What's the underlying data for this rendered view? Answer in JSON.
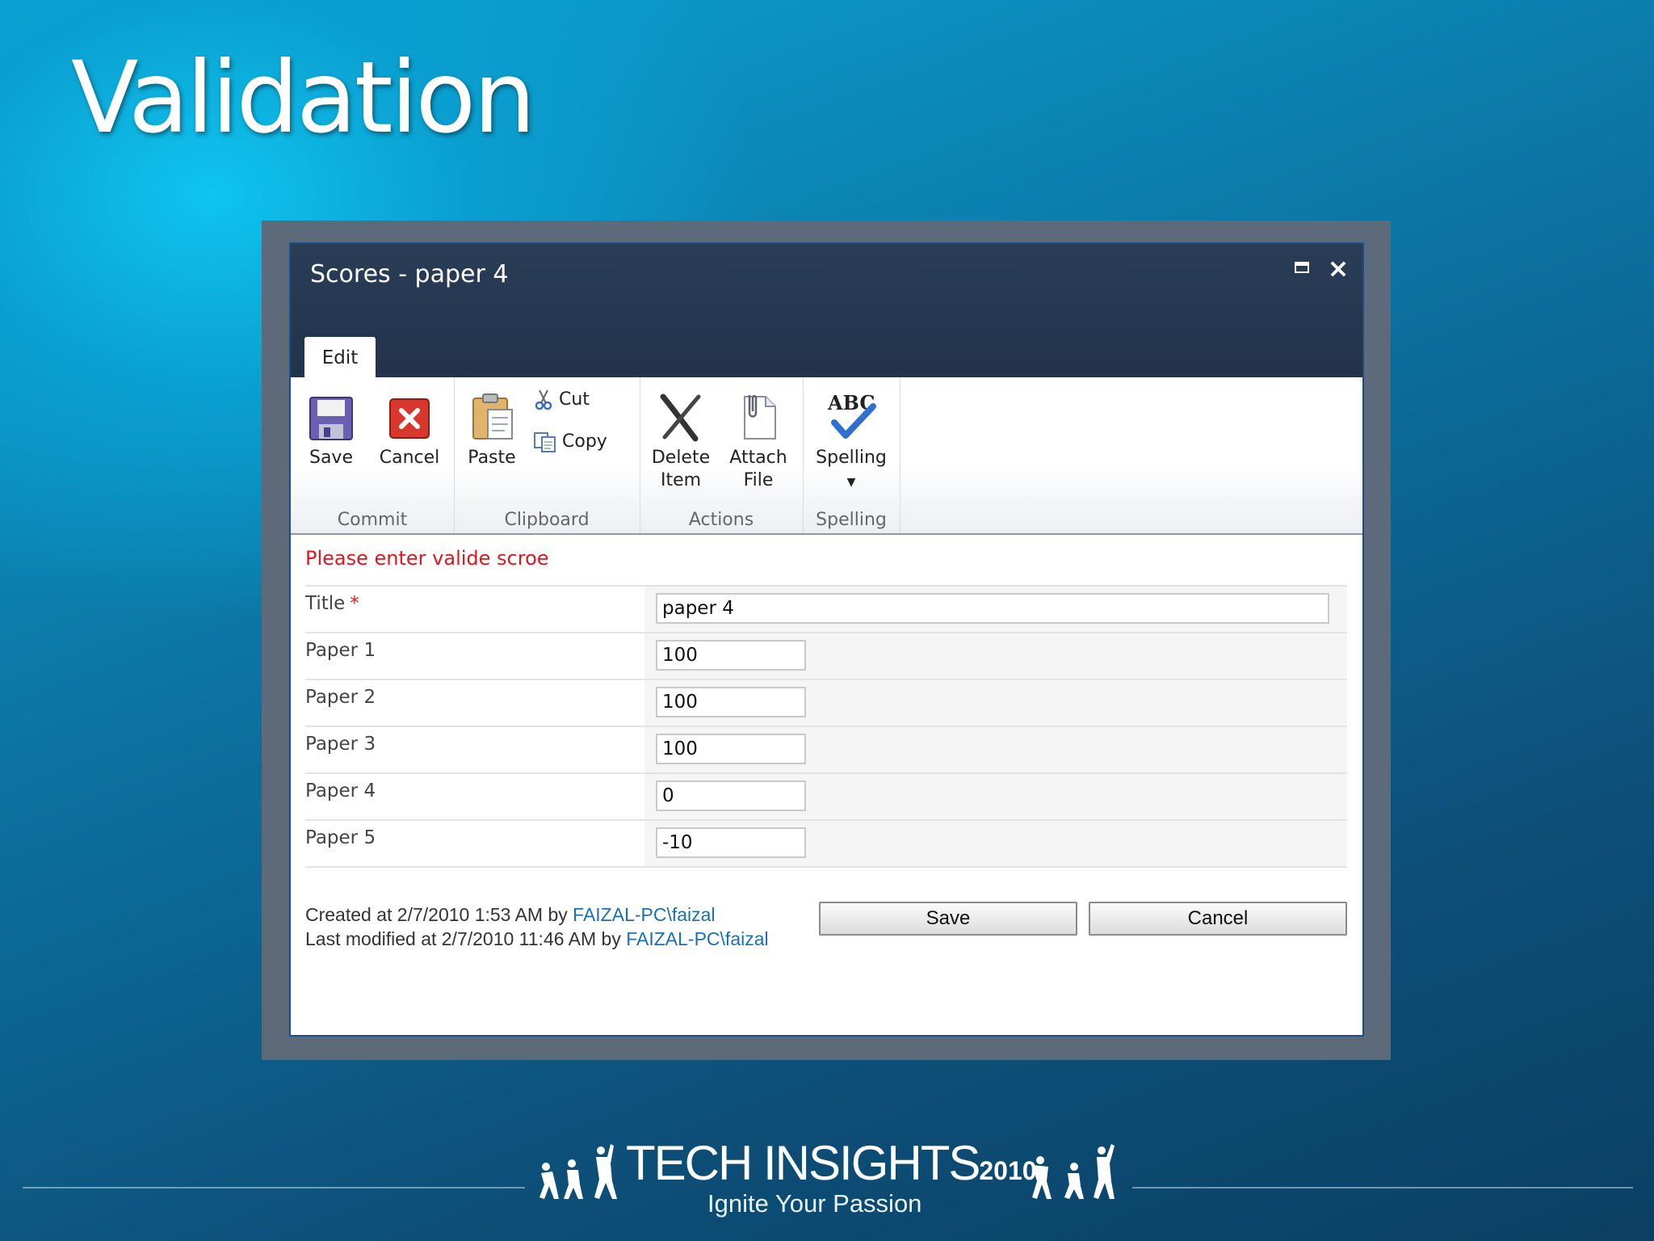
{
  "slide": {
    "title": "Validation"
  },
  "dialog": {
    "title": "Scores - paper 4",
    "tab_edit": "Edit"
  },
  "ribbon": {
    "save": "Save",
    "cancel": "Cancel",
    "group_commit": "Commit",
    "paste": "Paste",
    "cut": "Cut",
    "copy": "Copy",
    "group_clipboard": "Clipboard",
    "delete_line1": "Delete",
    "delete_line2": "Item",
    "attach_line1": "Attach",
    "attach_line2": "File",
    "group_actions": "Actions",
    "spelling": "Spelling",
    "group_spelling": "Spelling",
    "abc": "ABC"
  },
  "form": {
    "error": "Please enter valide scroe",
    "required_mark": "*",
    "fields": [
      {
        "label": "Title",
        "value": "paper 4"
      },
      {
        "label": "Paper 1",
        "value": "100"
      },
      {
        "label": "Paper 2",
        "value": "100"
      },
      {
        "label": "Paper 3",
        "value": "100"
      },
      {
        "label": "Paper 4",
        "value": "0"
      },
      {
        "label": "Paper 5",
        "value": "-10"
      }
    ],
    "created_prefix": "Created at 2/7/2010 1:53 AM by ",
    "created_user": "FAIZAL-PC\\faizal",
    "modified_prefix": "Last modified at 2/7/2010 11:46 AM by ",
    "modified_user": "FAIZAL-PC\\faizal",
    "save_button": "Save",
    "cancel_button": "Cancel"
  },
  "footer": {
    "brand": "TECH INSIGHTS",
    "year": "2010",
    "tagline": "Ignite Your Passion"
  },
  "colors": {
    "error": "#e0161e",
    "link": "#1a6fb5",
    "titlebar": "#22334b",
    "frame": "#5c6a79"
  }
}
